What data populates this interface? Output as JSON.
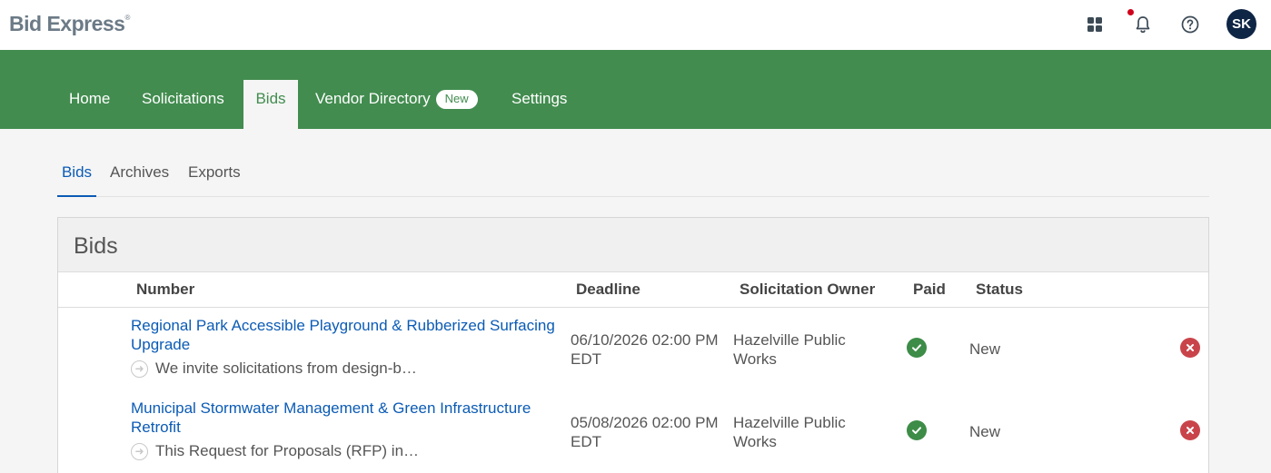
{
  "app": {
    "logo": "Bid Express",
    "logo_mark": "®",
    "avatar_initials": "SK"
  },
  "icons": {
    "apps": "apps-grid-icon",
    "notifications": "bell-icon",
    "help": "help-circle-icon",
    "paid": "check-circle-icon",
    "remove": "close-circle-icon",
    "expand": "arrow-right-circle-icon"
  },
  "colors": {
    "nav_green": "#428c4f",
    "link_blue": "#0b5bb5",
    "avatar_bg": "#0f2545",
    "paid_green": "#3d8c47",
    "remove_red": "#c9444a",
    "notification_dot": "#d0021b"
  },
  "nav": {
    "home": "Home",
    "solicitations": "Solicitations",
    "bids": "Bids",
    "vendor_directory": "Vendor Directory",
    "vendor_badge": "New",
    "settings": "Settings",
    "active": "Bids"
  },
  "subtabs": {
    "bids": "Bids",
    "archives": "Archives",
    "exports": "Exports",
    "active": "Bids"
  },
  "panel": {
    "title": "Bids",
    "columns": {
      "number": "Number",
      "deadline": "Deadline",
      "owner": "Solicitation Owner",
      "paid": "Paid",
      "status": "Status"
    },
    "rows": [
      {
        "title": "Regional Park Accessible Playground & Rubberized Surfacing Upgrade",
        "description": "We invite solicitations from design-b…",
        "deadline": "06/10/2026 02:00 PM EDT",
        "owner": "Hazelville Public Works",
        "paid": true,
        "status": "New"
      },
      {
        "title": "Municipal Stormwater Management & Green Infrastructure Retrofit",
        "description": "This Request for Proposals (RFP) in…",
        "deadline": "05/08/2026 02:00 PM EDT",
        "owner": "Hazelville Public Works",
        "paid": true,
        "status": "New"
      }
    ]
  }
}
